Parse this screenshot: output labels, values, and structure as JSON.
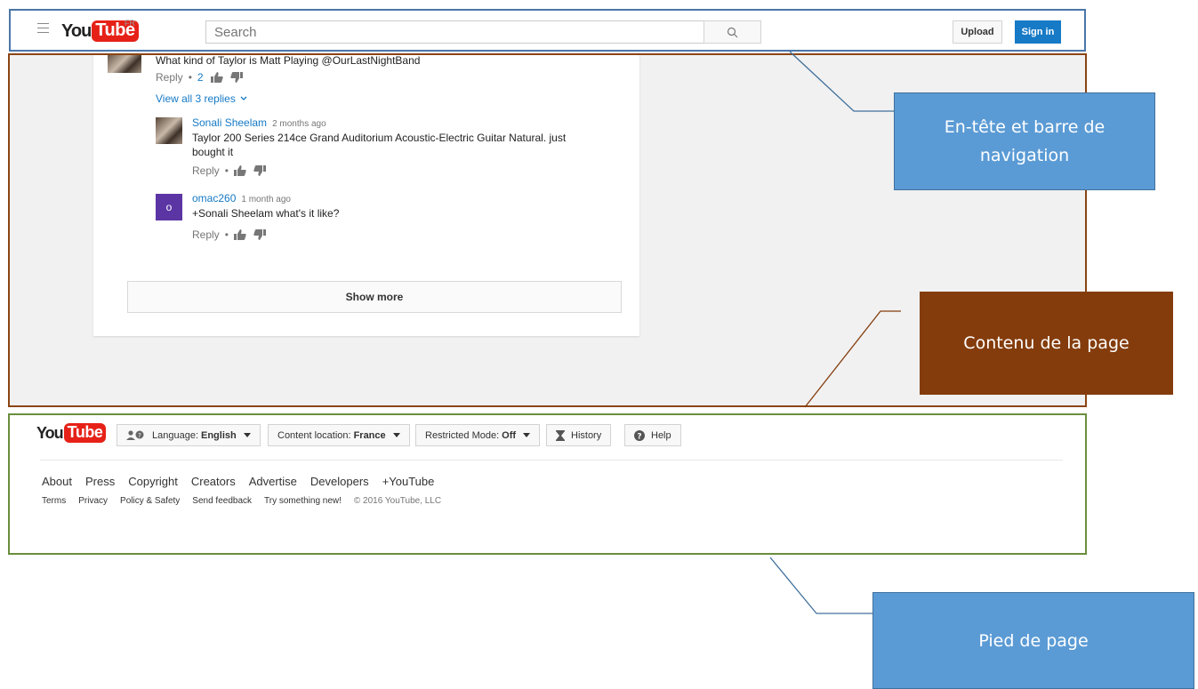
{
  "header": {
    "logo_you": "You",
    "logo_tube": "Tube",
    "country": "FR",
    "search_placeholder": "Search",
    "upload_label": "Upload",
    "signin_label": "Sign in"
  },
  "comments": {
    "top_comment_text": "What kind of Taylor is Matt Playing @OurLastNightBand",
    "top_reply_label": "Reply",
    "top_like_count": "2",
    "view_replies_label": "View all 3 replies",
    "replies": [
      {
        "author": "Sonali Sheelam",
        "time": "2 months ago",
        "text": "Taylor 200 Series 214ce Grand Auditorium Acoustic-Electric Guitar Natural. just bought it",
        "reply_label": "Reply"
      },
      {
        "author": "omac260",
        "avatar_letter": "o",
        "time": "1 month ago",
        "text": "+Sonali Sheelam what's it like?",
        "reply_label": "Reply"
      }
    ],
    "show_more_label": "Show more"
  },
  "footer": {
    "logo_you": "You",
    "logo_tube": "Tube",
    "language_label": "Language:",
    "language_value": "English",
    "location_label": "Content location:",
    "location_value": "France",
    "restricted_label": "Restricted Mode:",
    "restricted_value": "Off",
    "history_label": "History",
    "help_label": "Help",
    "links_primary": [
      "About",
      "Press",
      "Copyright",
      "Creators",
      "Advertise",
      "Developers",
      "+YouTube"
    ],
    "links_secondary": [
      "Terms",
      "Privacy",
      "Policy & Safety",
      "Send feedback",
      "Try something new!"
    ],
    "copyright": "© 2016 YouTube, LLC"
  },
  "annotations": {
    "header": "En-tête et barre de navigation",
    "content": "Contenu de la page",
    "footer": "Pied de page"
  },
  "colors": {
    "header_outline": "#4a76a8",
    "content_outline": "#8b4513",
    "footer_outline": "#6a8e3c",
    "callout_blue": "#5b9bd5",
    "callout_brown": "#843c0c",
    "youtube_red": "#e62117",
    "link_blue": "#167ac6"
  }
}
